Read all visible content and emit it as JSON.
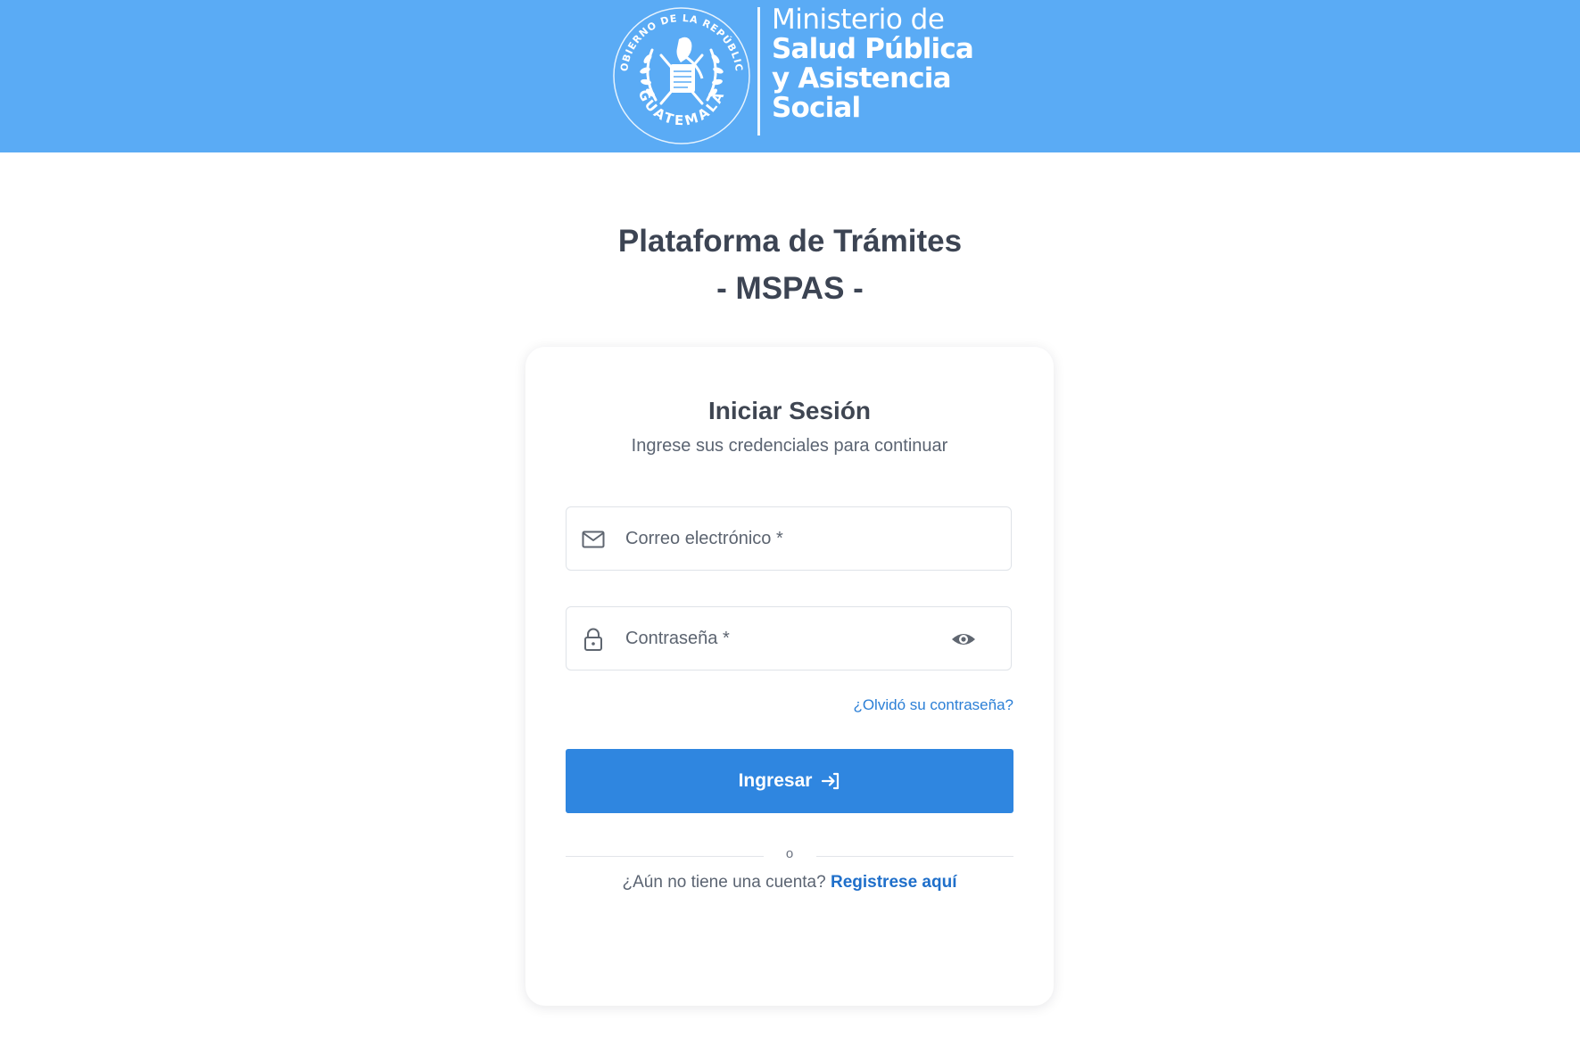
{
  "header": {
    "background_color": "#5aabf5",
    "seal": {
      "icon": "guatemala-coat-of-arms-seal",
      "text_top": "GOBIERNO DE LA REPÚBLICA",
      "text_bottom": "GUATEMALA"
    },
    "brand": {
      "line1": "Ministerio de",
      "line2": "Salud Pública",
      "line3": "y Asistencia",
      "line4": "Social"
    }
  },
  "page": {
    "title_line1": "Plataforma de Trámites",
    "title_line2": "- MSPAS -"
  },
  "login_card": {
    "title": "Iniciar Sesión",
    "subtitle": "Ingrese sus credenciales para continuar",
    "email": {
      "icon": "mail-icon",
      "placeholder": "Correo electrónico *",
      "value": ""
    },
    "password": {
      "icon": "lock-icon",
      "placeholder": "Contraseña *",
      "value": "",
      "toggle_icon": "eye-icon"
    },
    "forgot_password": "¿Olvidó su contraseña?",
    "submit": {
      "label": "Ingresar",
      "icon": "login-arrow-icon",
      "color": "#2f86e0"
    },
    "divider_text": "o",
    "register_prompt": "¿Aún no tiene una cuenta?",
    "register_link": "Registrese aquí",
    "link_color": "#1f6fca"
  }
}
